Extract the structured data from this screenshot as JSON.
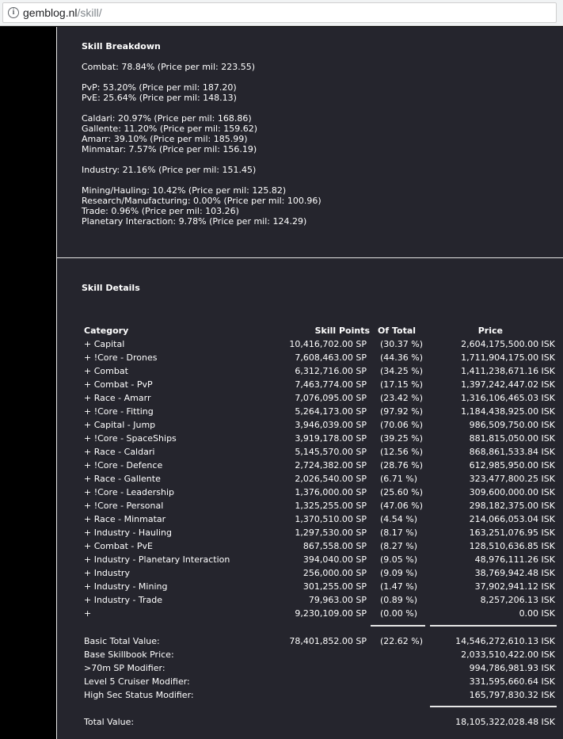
{
  "browser": {
    "url_host": "gemblog.nl",
    "url_path": "/skill/"
  },
  "breakdown": {
    "title": "Skill Breakdown",
    "groups": [
      [
        "Combat: 78.84% (Price per mil: 223.55)"
      ],
      [
        "PvP: 53.20% (Price per mil: 187.20)",
        "PvE: 25.64% (Price per mil: 148.13)"
      ],
      [
        "Caldari: 20.97% (Price per mil: 168.86)",
        "Gallente: 11.20% (Price per mil: 159.62)",
        "Amarr: 39.10% (Price per mil: 185.99)",
        "Minmatar: 7.57% (Price per mil: 156.19)"
      ],
      [
        "Industry: 21.16% (Price per mil: 151.45)"
      ],
      [
        "Mining/Hauling: 10.42% (Price per mil: 125.82)",
        "Research/Manufacturing: 0.00% (Price per mil: 100.96)",
        "Trade: 0.96% (Price per mil: 103.26)",
        "Planetary Interaction: 9.78% (Price per mil: 124.29)"
      ]
    ]
  },
  "details": {
    "title": "Skill Details",
    "headers": {
      "category": "Category",
      "skill_points": "Skill Points",
      "of_total": "Of Total",
      "price": "Price"
    },
    "rows": [
      {
        "category": "+ Capital",
        "sp": "10,416,702.00 SP",
        "pct": "(30.37 %)",
        "price": "2,604,175,500.00 ISK"
      },
      {
        "category": "+ !Core - Drones",
        "sp": "7,608,463.00 SP",
        "pct": "(44.36 %)",
        "price": "1,711,904,175.00 ISK"
      },
      {
        "category": "+ Combat",
        "sp": "6,312,716.00 SP",
        "pct": "(34.25 %)",
        "price": "1,411,238,671.16 ISK"
      },
      {
        "category": "+ Combat - PvP",
        "sp": "7,463,774.00 SP",
        "pct": "(17.15 %)",
        "price": "1,397,242,447.02 ISK"
      },
      {
        "category": "+ Race - Amarr",
        "sp": "7,076,095.00 SP",
        "pct": "(23.42 %)",
        "price": "1,316,106,465.03 ISK"
      },
      {
        "category": "+ !Core - Fitting",
        "sp": "5,264,173.00 SP",
        "pct": "(97.92 %)",
        "price": "1,184,438,925.00 ISK"
      },
      {
        "category": "+ Capital - Jump",
        "sp": "3,946,039.00 SP",
        "pct": "(70.06 %)",
        "price": "986,509,750.00 ISK"
      },
      {
        "category": "+ !Core - SpaceShips",
        "sp": "3,919,178.00 SP",
        "pct": "(39.25 %)",
        "price": "881,815,050.00 ISK"
      },
      {
        "category": "+ Race - Caldari",
        "sp": "5,145,570.00 SP",
        "pct": "(12.56 %)",
        "price": "868,861,533.84 ISK"
      },
      {
        "category": "+ !Core - Defence",
        "sp": "2,724,382.00 SP",
        "pct": "(28.76 %)",
        "price": "612,985,950.00 ISK"
      },
      {
        "category": "+ Race - Gallente",
        "sp": "2,026,540.00 SP",
        "pct": "(6.71 %)",
        "price": "323,477,800.25 ISK"
      },
      {
        "category": "+ !Core - Leadership",
        "sp": "1,376,000.00 SP",
        "pct": "(25.60 %)",
        "price": "309,600,000.00 ISK"
      },
      {
        "category": "+ !Core - Personal",
        "sp": "1,325,255.00 SP",
        "pct": "(47.06 %)",
        "price": "298,182,375.00 ISK"
      },
      {
        "category": "+ Race - Minmatar",
        "sp": "1,370,510.00 SP",
        "pct": "(4.54 %)",
        "price": "214,066,053.04 ISK"
      },
      {
        "category": "+ Industry - Hauling",
        "sp": "1,297,530.00 SP",
        "pct": "(8.17 %)",
        "price": "163,251,076.95 ISK"
      },
      {
        "category": "+ Combat - PvE",
        "sp": "867,558.00 SP",
        "pct": "(8.27 %)",
        "price": "128,510,636.85 ISK"
      },
      {
        "category": "+ Industry - Planetary Interaction",
        "sp": "394,040.00 SP",
        "pct": "(9.05 %)",
        "price": "48,976,111.26 ISK"
      },
      {
        "category": "+ Industry",
        "sp": "256,000.00 SP",
        "pct": "(9.09 %)",
        "price": "38,769,942.48 ISK"
      },
      {
        "category": "+ Industry - Mining",
        "sp": "301,255.00 SP",
        "pct": "(1.47 %)",
        "price": "37,902,941.12 ISK"
      },
      {
        "category": "+ Industry - Trade",
        "sp": "79,963.00 SP",
        "pct": "(0.89 %)",
        "price": "8,257,206.13 ISK"
      },
      {
        "category": "+",
        "sp": "9,230,109.00 SP",
        "pct": "(0.00 %)",
        "price": "0.00 ISK"
      }
    ],
    "summary": [
      {
        "label": "Basic Total Value:",
        "sp": "78,401,852.00 SP",
        "pct": "(22.62 %)",
        "price": "14,546,272,610.13 ISK"
      },
      {
        "label": "Base Skillbook Price:",
        "sp": "",
        "pct": "",
        "price": "2,033,510,422.00 ISK"
      },
      {
        "label": ">70m SP Modifier:",
        "sp": "",
        "pct": "",
        "price": "994,786,981.93 ISK"
      },
      {
        "label": "Level 5 Cruiser Modifier:",
        "sp": "",
        "pct": "",
        "price": "331,595,660.64 ISK"
      },
      {
        "label": "High Sec Status Modifier:",
        "sp": "",
        "pct": "",
        "price": "165,797,830.32 ISK"
      }
    ],
    "total": {
      "label": "Total Value:",
      "price": "18,105,322,028.48 ISK"
    }
  }
}
